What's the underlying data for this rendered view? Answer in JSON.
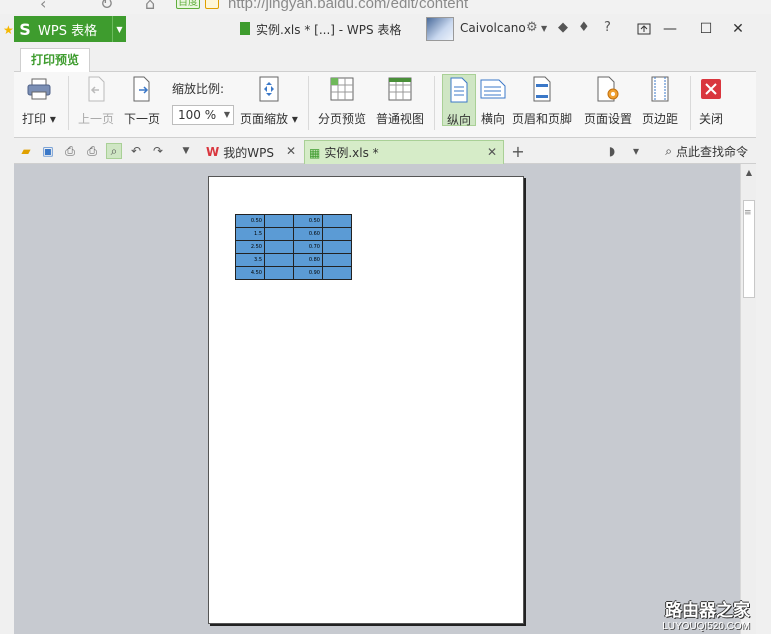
{
  "browser": {
    "url": "http://jingyan.baidu.com/edit/content",
    "baidu_chip": "百度"
  },
  "app": {
    "name": "WPS 表格",
    "logo": "S"
  },
  "window": {
    "title": "实例.xls * [...] - WPS 表格",
    "username": "Caivolcano"
  },
  "ribbon_tab": "打印预览",
  "ribbon": {
    "print": "打印",
    "prev_page": "上一页",
    "next_page": "下一页",
    "zoom_label": "缩放比例:",
    "zoom_value": "100 %",
    "page_zoom": "页面缩放",
    "page_break_preview": "分页预览",
    "normal_view": "普通视图",
    "portrait": "纵向",
    "landscape": "横向",
    "header_footer": "页眉和页脚",
    "page_setup": "页面设置",
    "margins": "页边距",
    "close": "关闭"
  },
  "doc_tabs": [
    {
      "label": "我的WPS"
    },
    {
      "label": "实例.xls *"
    }
  ],
  "find_command": "点此查找命令",
  "sheet_cells": [
    [
      "0.50",
      "",
      "0.50",
      ""
    ],
    [
      "1.5",
      "",
      "0.60",
      ""
    ],
    [
      "2.50",
      "",
      "0.70",
      ""
    ],
    [
      "3.5",
      "",
      "0.80",
      ""
    ],
    [
      "4.50",
      "",
      "0.90",
      ""
    ]
  ],
  "watermark": {
    "line1": "路由器之家",
    "line2": "LUYOUQI520.COM"
  },
  "colors": {
    "accent": "#3e9c2e",
    "cell_fill": "#5b9bd5",
    "preview_bg": "#c7cad0"
  }
}
